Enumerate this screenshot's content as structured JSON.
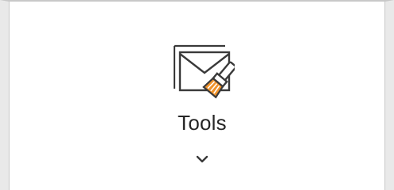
{
  "ribbon": {
    "tools_button": {
      "label": "Tools",
      "icon": "mail-cleanup-icon",
      "dropdown_icon": "chevron-down-icon"
    }
  },
  "colors": {
    "icon_stroke": "#3a3a3a",
    "brush_accent": "#f0932b",
    "background": "#ffffff",
    "frame": "#e9e9e9"
  }
}
